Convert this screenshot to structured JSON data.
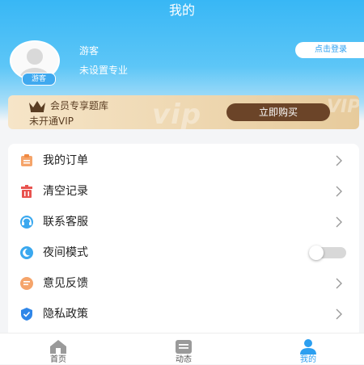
{
  "header": {
    "title": "我的"
  },
  "profile": {
    "badge": "游客",
    "name": "游客",
    "major": "未设置专业",
    "login_button": "点击登录"
  },
  "vip_card": {
    "title": "会员专享题库",
    "subtitle": "未开通VIP",
    "buy_button": "立即购买",
    "watermark_left": "vip",
    "watermark_right": "VIP"
  },
  "menu": {
    "items": [
      {
        "label": "我的订单",
        "icon": "order-icon",
        "color": "#f5a46a"
      },
      {
        "label": "清空记录",
        "icon": "trash-icon",
        "color": "#e8534f"
      },
      {
        "label": "联系客服",
        "icon": "customer-service-icon",
        "color": "#3aa8ef"
      },
      {
        "label": "夜间模式",
        "icon": "moon-icon",
        "color": "#3aa8ef",
        "toggle": false
      },
      {
        "label": "意见反馈",
        "icon": "feedback-icon",
        "color": "#f5a46a"
      },
      {
        "label": "隐私政策",
        "icon": "shield-icon",
        "color": "#2f86e8"
      }
    ]
  },
  "tabbar": {
    "tabs": [
      {
        "label": "首页",
        "icon": "home-icon",
        "active": false
      },
      {
        "label": "动态",
        "icon": "news-icon",
        "active": false
      },
      {
        "label": "我的",
        "icon": "user-icon",
        "active": true
      }
    ]
  },
  "colors": {
    "accent": "#2c9ff0",
    "header_top": "#38b7f5",
    "vip_button": "#6b4428"
  }
}
